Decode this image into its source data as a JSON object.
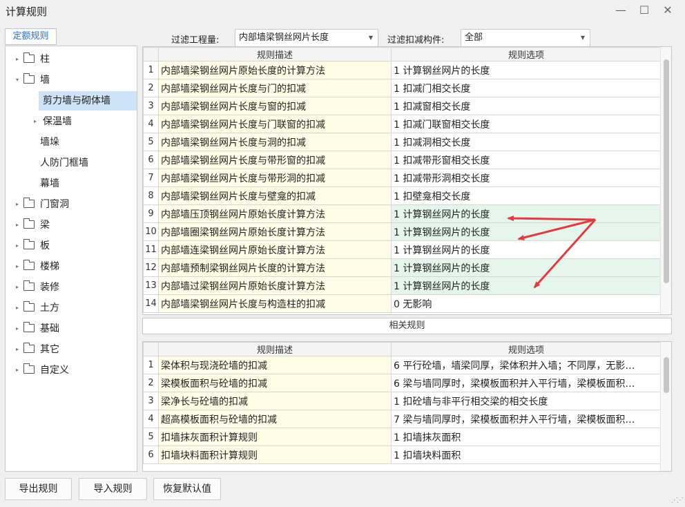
{
  "window": {
    "title": "计算规则",
    "minimize": "—",
    "maximize": "☐",
    "close": "✕"
  },
  "tab": {
    "label": "定额规则"
  },
  "filters": {
    "project_label": "过滤工程量:",
    "project_value": "内部墙梁钢丝网片长度",
    "component_label": "过滤扣减构件:",
    "component_value": "全部"
  },
  "tree": [
    {
      "label": "柱",
      "level": 0,
      "expander": "▸",
      "folder": true,
      "selected": false
    },
    {
      "label": "墙",
      "level": 0,
      "expander": "▾",
      "folder": true,
      "selected": false
    },
    {
      "label": "剪力墙与砌体墙",
      "level": 1,
      "expander": "",
      "folder": false,
      "selected": true
    },
    {
      "label": "保温墙",
      "level": 1,
      "expander": "▸",
      "folder": false,
      "selected": false
    },
    {
      "label": "墙垛",
      "level": 1,
      "expander": "",
      "folder": false,
      "selected": false
    },
    {
      "label": "人防门框墙",
      "level": 1,
      "expander": "",
      "folder": false,
      "selected": false
    },
    {
      "label": "幕墙",
      "level": 1,
      "expander": "",
      "folder": false,
      "selected": false
    },
    {
      "label": "门窗洞",
      "level": 0,
      "expander": "▸",
      "folder": true,
      "selected": false
    },
    {
      "label": "梁",
      "level": 0,
      "expander": "▸",
      "folder": true,
      "selected": false
    },
    {
      "label": "板",
      "level": 0,
      "expander": "▸",
      "folder": true,
      "selected": false
    },
    {
      "label": "楼梯",
      "level": 0,
      "expander": "▸",
      "folder": true,
      "selected": false
    },
    {
      "label": "装修",
      "level": 0,
      "expander": "▸",
      "folder": true,
      "selected": false
    },
    {
      "label": "土方",
      "level": 0,
      "expander": "▸",
      "folder": true,
      "selected": false
    },
    {
      "label": "基础",
      "level": 0,
      "expander": "▸",
      "folder": true,
      "selected": false
    },
    {
      "label": "其它",
      "level": 0,
      "expander": "▸",
      "folder": true,
      "selected": false
    },
    {
      "label": "自定义",
      "level": 0,
      "expander": "▸",
      "folder": true,
      "selected": false
    }
  ],
  "rules_table": {
    "headers": [
      "规则描述",
      "规则选项"
    ],
    "rows": [
      {
        "num": "1",
        "desc": "内部墙梁钢丝网片原始长度的计算方法",
        "opt": "1  计算钢丝网片的长度",
        "hl": false
      },
      {
        "num": "2",
        "desc": "内部墙梁钢丝网片长度与门的扣减",
        "opt": "1  扣减门相交长度",
        "hl": false
      },
      {
        "num": "3",
        "desc": "内部墙梁钢丝网片长度与窗的扣减",
        "opt": "1  扣减窗相交长度",
        "hl": false
      },
      {
        "num": "4",
        "desc": "内部墙梁钢丝网片长度与门联窗的扣减",
        "opt": "1  扣减门联窗相交长度",
        "hl": false
      },
      {
        "num": "5",
        "desc": "内部墙梁钢丝网片长度与洞的扣减",
        "opt": "1  扣减洞相交长度",
        "hl": false
      },
      {
        "num": "6",
        "desc": "内部墙梁钢丝网片长度与带形窗的扣减",
        "opt": "1  扣减带形窗相交长度",
        "hl": false
      },
      {
        "num": "7",
        "desc": "内部墙梁钢丝网片长度与带形洞的扣减",
        "opt": "1  扣减带形洞相交长度",
        "hl": false
      },
      {
        "num": "8",
        "desc": "内部墙梁钢丝网片长度与壁龛的扣减",
        "opt": "1  扣壁龛相交长度",
        "hl": false
      },
      {
        "num": "9",
        "desc": "内部墙压顶钢丝网片原始长度计算方法",
        "opt": "1  计算钢丝网片的长度",
        "hl": true
      },
      {
        "num": "10",
        "desc": "内部墙圈梁钢丝网片原始长度计算方法",
        "opt": "1  计算钢丝网片的长度",
        "hl": true
      },
      {
        "num": "11",
        "desc": "内部墙连梁钢丝网片原始长度计算方法",
        "opt": "1  计算钢丝网片的长度",
        "hl": false
      },
      {
        "num": "12",
        "desc": "内部墙预制梁钢丝网片长度的计算方法",
        "opt": "1  计算钢丝网片的长度",
        "hl": true
      },
      {
        "num": "13",
        "desc": "内部墙过梁钢丝网片原始长度计算方法",
        "opt": "1  计算钢丝网片的长度",
        "hl": true
      },
      {
        "num": "14",
        "desc": "内部墙梁钢丝网片长度与构造柱的扣减",
        "opt": "0  无影响",
        "hl": false
      }
    ]
  },
  "related_label": "相关规则",
  "related_table": {
    "headers": [
      "规则描述",
      "规则选项"
    ],
    "rows": [
      {
        "num": "1",
        "desc": "梁体积与现浇砼墙的扣减",
        "opt": "6 平行砼墙，墙梁同厚，梁体积并入墙；不同厚，无影…"
      },
      {
        "num": "2",
        "desc": "梁模板面积与砼墙的扣减",
        "opt": "6 梁与墙同厚时，梁模板面积并入平行墙，梁模板面积…"
      },
      {
        "num": "3",
        "desc": "梁净长与砼墙的扣减",
        "opt": "1 扣砼墙与非平行相交梁的相交长度"
      },
      {
        "num": "4",
        "desc": "超高模板面积与砼墙的扣减",
        "opt": "7 梁与墙同厚时，梁模板面积并入平行墙，梁模板面积…"
      },
      {
        "num": "5",
        "desc": "扣墙抹灰面积计算规则",
        "opt": "1 扣墙抹灰面积"
      },
      {
        "num": "6",
        "desc": "扣墙块料面积计算规则",
        "opt": "1 扣墙块料面积"
      }
    ]
  },
  "buttons": {
    "export": "导出规则",
    "import": "导入规则",
    "reset": "恢复默认值"
  },
  "colors": {
    "annotation_arrow": "#e8383d",
    "highlight_row": "#e4f6ec",
    "desc_cell": "#fffde6",
    "selected_tree": "#cde3f8",
    "accent": "#1f6fd3"
  }
}
